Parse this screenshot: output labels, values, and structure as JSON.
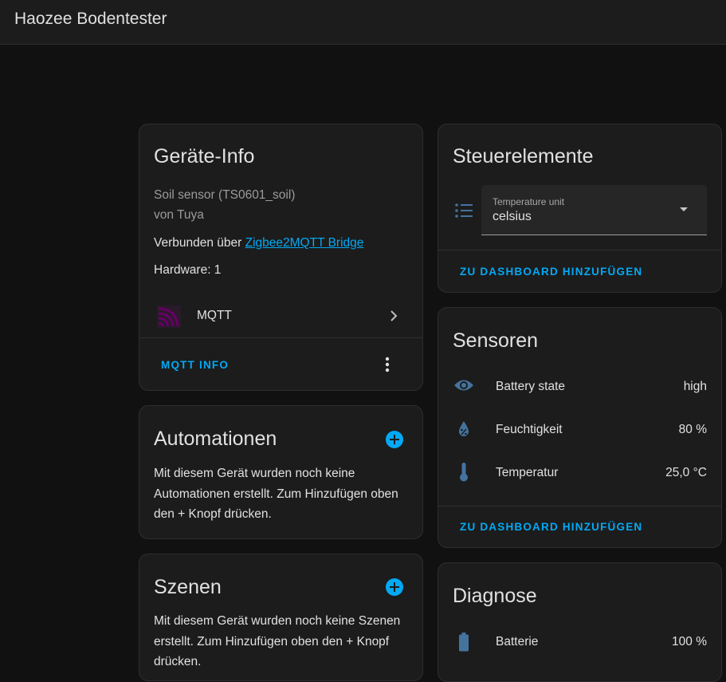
{
  "header": {
    "title": "Haozee Bodentester"
  },
  "device_info": {
    "title": "Geräte-Info",
    "model": "Soil sensor (TS0601_soil)",
    "manufacturer": "von Tuya",
    "connected_prefix": "Verbunden über ",
    "connected_link": "Zigbee2MQTT Bridge",
    "hardware": "Hardware: 1",
    "integration_label": "MQTT",
    "action_label": "MQTT INFO",
    "icons": {
      "integration": "mqtt-logo-icon",
      "chevron": "chevron-right-icon",
      "menu": "more-vert-icon"
    }
  },
  "automations": {
    "title": "Automationen",
    "text": "Mit diesem Gerät wurden noch keine Automationen erstellt. Zum Hinzufügen oben den + Knopf drücken."
  },
  "scenes": {
    "title": "Szenen",
    "text": "Mit diesem Gerät wurden noch keine Szenen erstellt. Zum Hinzufügen oben den + Knopf drücken."
  },
  "controls": {
    "title": "Steuerelemente",
    "select_label": "Temperature unit",
    "select_value": "celsius",
    "action_label": "ZU DASHBOARD HINZUFÜGEN",
    "icons": {
      "select": "format-list-icon",
      "dropdown": "arrow-drop-down-icon"
    }
  },
  "sensors": {
    "title": "Sensoren",
    "items": [
      {
        "label": "Battery state",
        "value": "high",
        "icon": "eye-icon"
      },
      {
        "label": "Feuchtigkeit",
        "value": "80 %",
        "icon": "water-percent-icon"
      },
      {
        "label": "Temperatur",
        "value": "25,0 °C",
        "icon": "thermometer-icon"
      }
    ],
    "action_label": "ZU DASHBOARD HINZUFÜGEN"
  },
  "diagnostics": {
    "title": "Diagnose",
    "items": [
      {
        "label": "Batterie",
        "value": "100 %",
        "icon": "battery-icon"
      }
    ]
  },
  "colors": {
    "accent": "#03a9f4",
    "icon": "#44739e",
    "background": "#111111",
    "card": "#1c1c1c",
    "mqtt_logo": "#660066"
  }
}
